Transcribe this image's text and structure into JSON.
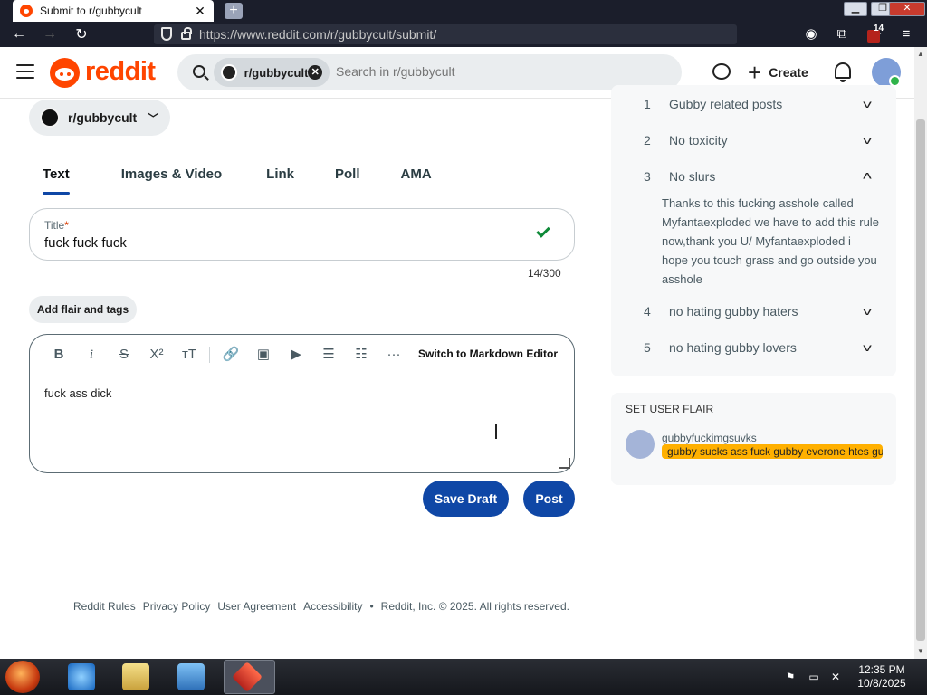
{
  "browser": {
    "tab_title": "Submit to r/gubbycult",
    "tab_close": "✕",
    "new_tab": "+",
    "url": "https://www.reddit.com/r/gubbycult/submit/",
    "ext_badge": "14"
  },
  "header": {
    "wordmark": "reddit",
    "search_chip": "r/gubbycult",
    "search_placeholder": "Search in r/gubbycult",
    "create_label": "Create"
  },
  "community": {
    "name": "r/gubbycult"
  },
  "post_tabs": [
    {
      "label": "Text",
      "active": true
    },
    {
      "label": "Images & Video",
      "active": false
    },
    {
      "label": "Link",
      "active": false
    },
    {
      "label": "Poll",
      "active": false
    },
    {
      "label": "AMA",
      "active": false
    }
  ],
  "title_field": {
    "label": "Title",
    "required_mark": "*",
    "value": "fuck fuck fuck",
    "count": "14/300"
  },
  "flair_button": "Add flair and tags",
  "editor": {
    "toolbar": {
      "bold": "B",
      "italic": "i",
      "strike": "S",
      "superscript": "X²",
      "heading": "тT",
      "link": "🔗",
      "image": "▣",
      "video": "▶",
      "bullets": "☰",
      "numbered": "☷",
      "more": "···"
    },
    "markdown_switch": "Switch to Markdown Editor",
    "body": "fuck ass dick"
  },
  "actions": {
    "save_draft": "Save Draft",
    "post": "Post"
  },
  "footer": {
    "links": [
      "Reddit Rules",
      "Privacy Policy",
      "User Agreement",
      "Accessibility"
    ],
    "bullet": "•",
    "copyright": "Reddit, Inc. © 2025. All rights reserved."
  },
  "rules": [
    {
      "num": "1",
      "title": "Gubby related posts",
      "expanded": false
    },
    {
      "num": "2",
      "title": "No toxicity",
      "expanded": false
    },
    {
      "num": "3",
      "title": "No slurs",
      "expanded": true
    },
    {
      "num": "4",
      "title": "no hating gubby haters",
      "expanded": false
    },
    {
      "num": "5",
      "title": "no hating gubby lovers",
      "expanded": false
    }
  ],
  "rule_3_body": "Thanks to this fucking asshole called Myfantaexploded we have to add this rule now,thank you U/ Myfantaexploded i hope you touch grass and go outside you asshole",
  "user_flair": {
    "heading": "SET USER FLAIR",
    "username": "gubbyfuckimgsuvks",
    "flair": "gubby sucks ass fuck gubby everone htes gubby"
  },
  "taskbar": {
    "time": "12:35 PM",
    "date": "10/8/2025"
  },
  "colors": {
    "reddit_orange": "#ff4500",
    "primary_blue": "#0f47a6",
    "flair_yellow": "#ffb000",
    "check_green": "#0e8a38"
  }
}
